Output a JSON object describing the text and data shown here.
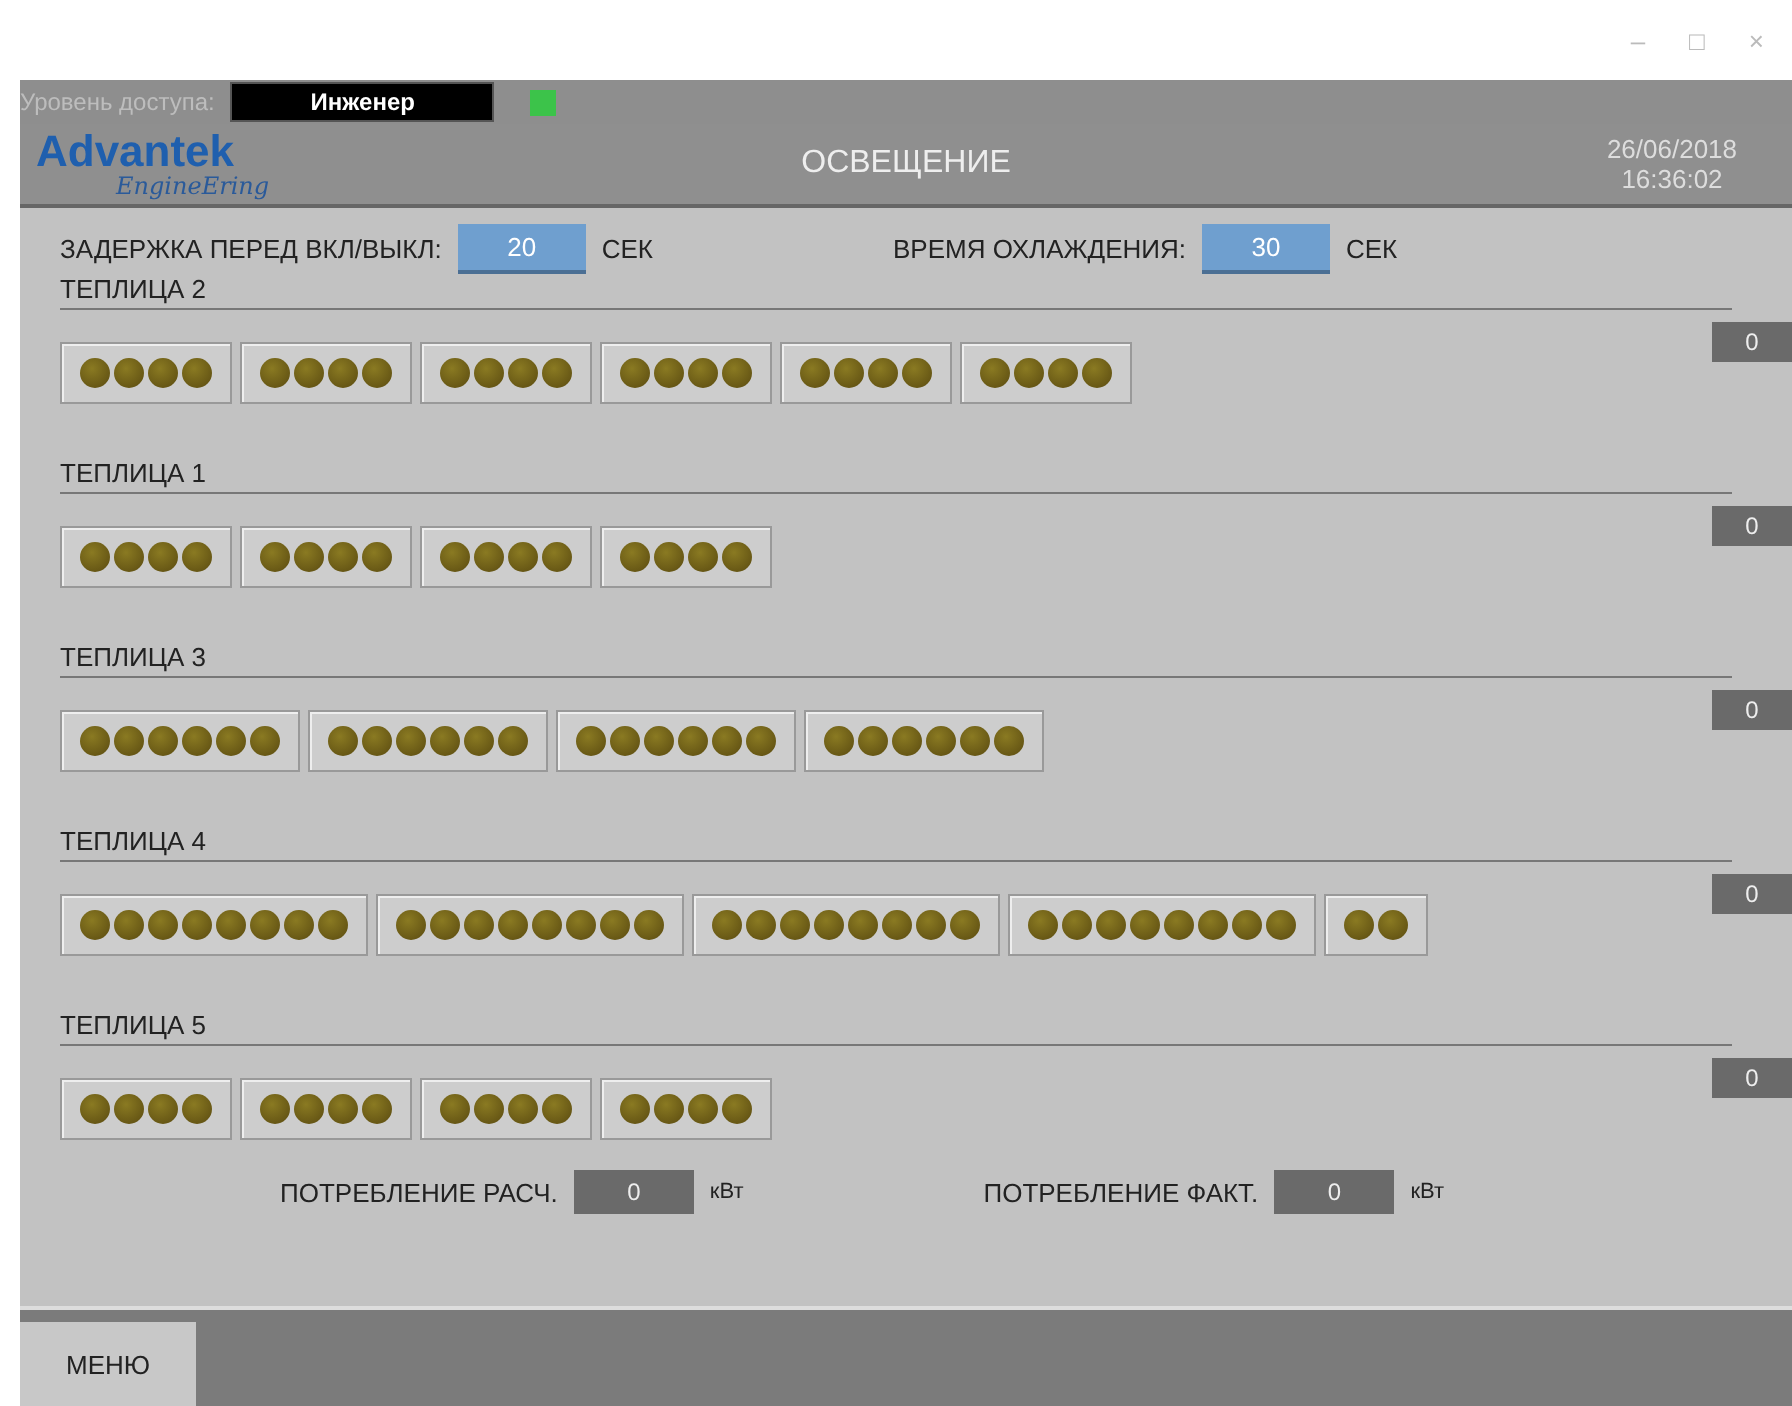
{
  "window_controls": [
    "–",
    "□",
    "×"
  ],
  "access": {
    "label": "Уровень доступа:",
    "value": "Инженер",
    "indicator_on": true
  },
  "header": {
    "logo_top": "Advantek",
    "logo_bottom": "EngineEring",
    "title": "ОСВЕЩЕНИЕ",
    "date": "26/06/2018",
    "time": "16:36:02"
  },
  "settings": [
    {
      "label": "ЗАДЕРЖКА ПЕРЕД ВКЛ/ВЫКЛ:",
      "value": "20",
      "unit": "СЕК"
    },
    {
      "label": "ВРЕМЯ ОХЛАЖДЕНИЯ:",
      "value": "30",
      "unit": "СЕК"
    }
  ],
  "greenhouses": [
    {
      "name": "ТЕПЛИЦА 2",
      "counter": "0",
      "groups": [
        {
          "lamps": [
            {
              "on": false
            },
            {
              "on": false
            },
            {
              "on": false
            },
            {
              "on": false
            }
          ]
        },
        {
          "lamps": [
            {
              "on": false
            },
            {
              "on": false
            },
            {
              "on": false
            },
            {
              "on": false
            }
          ]
        },
        {
          "lamps": [
            {
              "on": false
            },
            {
              "on": false
            },
            {
              "on": false
            },
            {
              "on": false
            }
          ]
        },
        {
          "lamps": [
            {
              "on": false
            },
            {
              "on": false
            },
            {
              "on": false
            },
            {
              "on": false
            }
          ]
        },
        {
          "lamps": [
            {
              "on": false
            },
            {
              "on": false
            },
            {
              "on": false
            },
            {
              "on": false
            }
          ]
        },
        {
          "lamps": [
            {
              "on": false
            },
            {
              "on": false
            },
            {
              "on": false
            },
            {
              "on": false
            }
          ]
        }
      ]
    },
    {
      "name": "ТЕПЛИЦА 1",
      "counter": "0",
      "groups": [
        {
          "lamps": [
            {
              "on": false
            },
            {
              "on": false
            },
            {
              "on": false
            },
            {
              "on": false
            }
          ]
        },
        {
          "lamps": [
            {
              "on": false
            },
            {
              "on": false
            },
            {
              "on": false
            },
            {
              "on": false
            }
          ]
        },
        {
          "lamps": [
            {
              "on": false
            },
            {
              "on": false
            },
            {
              "on": false
            },
            {
              "on": false
            }
          ]
        },
        {
          "lamps": [
            {
              "on": false
            },
            {
              "on": false
            },
            {
              "on": false
            },
            {
              "on": false
            }
          ]
        }
      ]
    },
    {
      "name": "ТЕПЛИЦА 3",
      "counter": "0",
      "groups": [
        {
          "lamps": [
            {
              "on": false
            },
            {
              "on": false
            },
            {
              "on": false
            },
            {
              "on": false
            },
            {
              "on": false
            },
            {
              "on": false
            }
          ]
        },
        {
          "lamps": [
            {
              "on": false
            },
            {
              "on": false
            },
            {
              "on": false
            },
            {
              "on": false
            },
            {
              "on": false
            },
            {
              "on": false
            }
          ]
        },
        {
          "lamps": [
            {
              "on": false
            },
            {
              "on": false
            },
            {
              "on": false
            },
            {
              "on": false
            },
            {
              "on": false
            },
            {
              "on": false
            }
          ]
        },
        {
          "lamps": [
            {
              "on": false
            },
            {
              "on": false
            },
            {
              "on": false
            },
            {
              "on": false
            },
            {
              "on": false
            },
            {
              "on": false
            }
          ]
        }
      ]
    },
    {
      "name": "ТЕПЛИЦА 4",
      "counter": "0",
      "groups": [
        {
          "lamps": [
            {
              "on": false
            },
            {
              "on": false
            },
            {
              "on": false
            },
            {
              "on": false
            },
            {
              "on": false
            },
            {
              "on": false
            },
            {
              "on": false
            },
            {
              "on": false
            }
          ]
        },
        {
          "lamps": [
            {
              "on": false
            },
            {
              "on": false
            },
            {
              "on": false
            },
            {
              "on": false
            },
            {
              "on": false
            },
            {
              "on": false
            },
            {
              "on": false
            },
            {
              "on": false
            }
          ]
        },
        {
          "lamps": [
            {
              "on": false
            },
            {
              "on": false
            },
            {
              "on": false
            },
            {
              "on": false
            },
            {
              "on": false
            },
            {
              "on": false
            },
            {
              "on": false
            },
            {
              "on": false
            }
          ]
        },
        {
          "lamps": [
            {
              "on": false
            },
            {
              "on": false
            },
            {
              "on": false
            },
            {
              "on": false
            },
            {
              "on": false
            },
            {
              "on": false
            },
            {
              "on": false
            },
            {
              "on": false
            }
          ]
        },
        {
          "lamps": [
            {
              "on": false
            },
            {
              "on": false
            }
          ]
        }
      ]
    },
    {
      "name": "ТЕПЛИЦА 5",
      "counter": "0",
      "groups": [
        {
          "lamps": [
            {
              "on": false
            },
            {
              "on": false
            },
            {
              "on": false
            },
            {
              "on": false
            }
          ]
        },
        {
          "lamps": [
            {
              "on": false
            },
            {
              "on": false
            },
            {
              "on": false
            },
            {
              "on": false
            }
          ]
        },
        {
          "lamps": [
            {
              "on": false
            },
            {
              "on": false
            },
            {
              "on": false
            },
            {
              "on": false
            }
          ]
        },
        {
          "lamps": [
            {
              "on": false
            },
            {
              "on": false
            },
            {
              "on": false
            },
            {
              "on": false
            }
          ]
        }
      ]
    }
  ],
  "consumption": [
    {
      "label": "ПОТРЕБЛЕНИЕ РАСЧ.",
      "value": "0",
      "unit": "кВт"
    },
    {
      "label": "ПОТРЕБЛЕНИЕ ФАКТ.",
      "value": "0",
      "unit": "кВт"
    }
  ],
  "menu_button": "МЕНЮ"
}
